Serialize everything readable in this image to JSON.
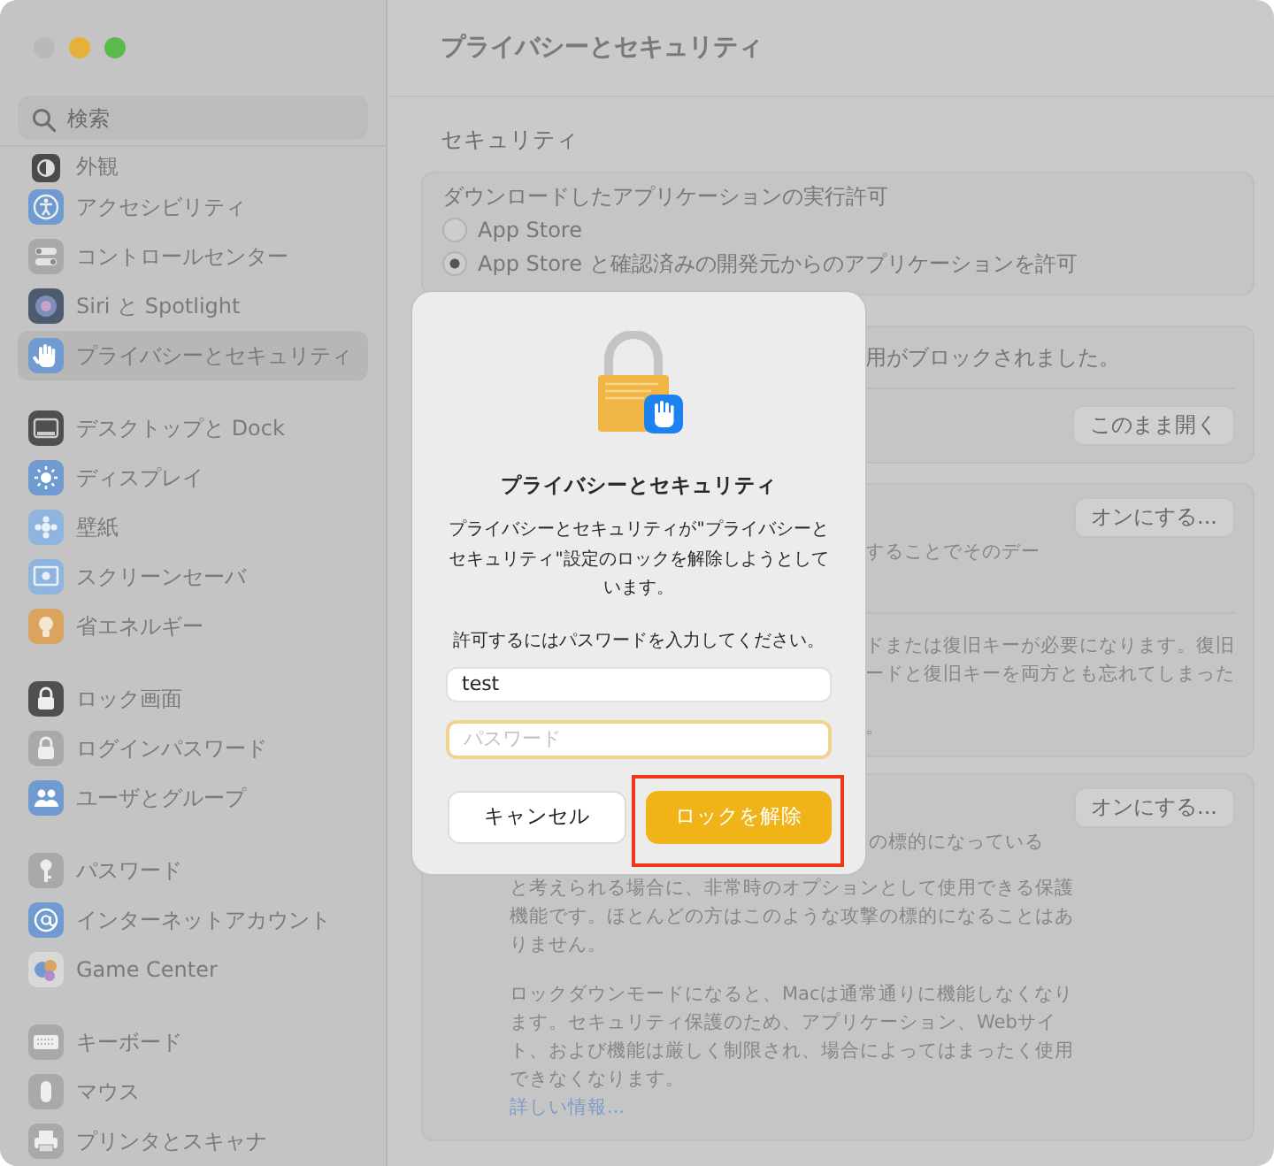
{
  "window": {
    "title": "プライバシーとセキュリティ"
  },
  "sidebar": {
    "search": {
      "placeholder": "検索"
    },
    "groups": [
      [
        {
          "label": "外観",
          "selected": false
        },
        {
          "label": "アクセシビリティ",
          "selected": false
        },
        {
          "label": "コントロールセンター",
          "selected": false
        },
        {
          "label": "Siri と Spotlight",
          "selected": false
        },
        {
          "label": "プライバシーとセキュリティ",
          "selected": true
        }
      ],
      [
        {
          "label": "デスクトップと Dock",
          "selected": false
        },
        {
          "label": "ディスプレイ",
          "selected": false
        },
        {
          "label": "壁紙",
          "selected": false
        },
        {
          "label": "スクリーンセーバ",
          "selected": false
        },
        {
          "label": "省エネルギー",
          "selected": false
        }
      ],
      [
        {
          "label": "ロック画面",
          "selected": false
        },
        {
          "label": "ログインパスワード",
          "selected": false
        },
        {
          "label": "ユーザとグループ",
          "selected": false
        }
      ],
      [
        {
          "label": "パスワード",
          "selected": false
        },
        {
          "label": "インターネットアカウント",
          "selected": false
        },
        {
          "label": "Game Center",
          "selected": false
        }
      ],
      [
        {
          "label": "キーボード",
          "selected": false
        },
        {
          "label": "マウス",
          "selected": false
        },
        {
          "label": "プリンタとスキャナ",
          "selected": false
        }
      ]
    ]
  },
  "content": {
    "section_title": "セキュリティ",
    "download_group": {
      "heading": "ダウンロードしたアプリケーションの実行許可",
      "options": [
        {
          "label": "App Store",
          "selected": false
        },
        {
          "label": "App Store と確認済みの開発元からのアプリケーションを許可",
          "selected": true
        }
      ]
    },
    "blocked_group": {
      "message": "用がブロックされました。",
      "button": "このまま開く"
    },
    "filevault_group": {
      "button": "オンにする...",
      "text_1": "することでそのデー",
      "text_2": [
        "ドまたは復旧キーが必要になります。復旧",
        "ードと復旧キーを両方とも忘れてしまった"
      ],
      "text_3": "。"
    },
    "lockdown_group": {
      "button": "オンにする...",
      "first_line": "の標的になっている",
      "paragraph_1": [
        "と考えられる場合に、非常時のオプションとして使用できる保護",
        "機能です。ほとんどの方はこのような攻撃の標的になることはあ",
        "りません。"
      ],
      "paragraph_2": [
        "ロックダウンモードになると、Macは通常通りに機能しなくなり",
        "ます。セキュリティ保護のため、アプリケーション、Webサイ",
        "ト、および機能は厳しく制限され、場合によってはまったく使用",
        "できなくなります。"
      ],
      "link": "詳しい情報..."
    }
  },
  "dialog": {
    "title": "プライバシーとセキュリティ",
    "message": "プライバシーとセキュリティが\"プライバシーとセキュリティ\"設定のロックを解除しようとしています。",
    "prompt": "許可するにはパスワードを入力してください。",
    "username": {
      "value": "test"
    },
    "password": {
      "placeholder": "パスワード"
    },
    "buttons": [
      {
        "label": "キャンセル",
        "kind": "secondary"
      },
      {
        "label": "ロックを解除",
        "kind": "primary"
      }
    ]
  }
}
